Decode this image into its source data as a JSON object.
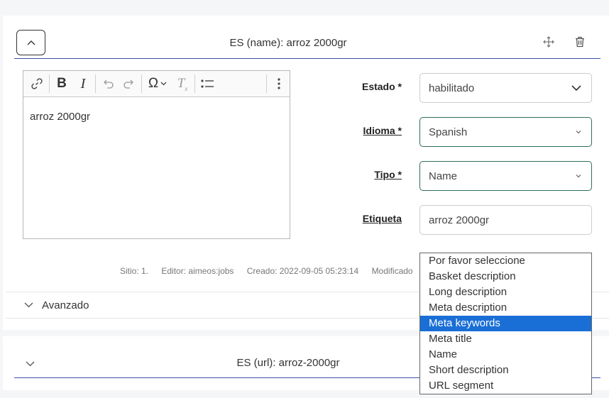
{
  "card1": {
    "title": "ES (name): arroz 2000gr",
    "editor": {
      "content": "arroz 2000gr"
    },
    "estado": {
      "label": "Estado *",
      "value": "habilitado"
    },
    "idioma": {
      "label": "Idioma *",
      "value": "Spanish"
    },
    "tipo": {
      "label": "Tipo *",
      "value": "Name"
    },
    "etiqueta": {
      "label": "Etiqueta",
      "value": "arroz 2000gr"
    },
    "meta": {
      "site": "Sitio: 1.",
      "editor": "Editor: aimeos:jobs",
      "created": "Creado: 2022-09-05 05:23:14",
      "modified": "Modificado"
    },
    "advanced": {
      "label": "Avanzado"
    }
  },
  "card2": {
    "title": "ES (url): arroz-2000gr"
  },
  "dropdown": {
    "options": [
      "Por favor seleccione",
      "Basket description",
      "Long description",
      "Meta description",
      "Meta keywords",
      "Meta title",
      "Name",
      "Short description",
      "URL segment"
    ],
    "selected": "Meta keywords"
  },
  "colors": {
    "accent_line": "#3a4fa8",
    "focus_border": "#2f6f53",
    "selected": "#1a6fd6"
  }
}
